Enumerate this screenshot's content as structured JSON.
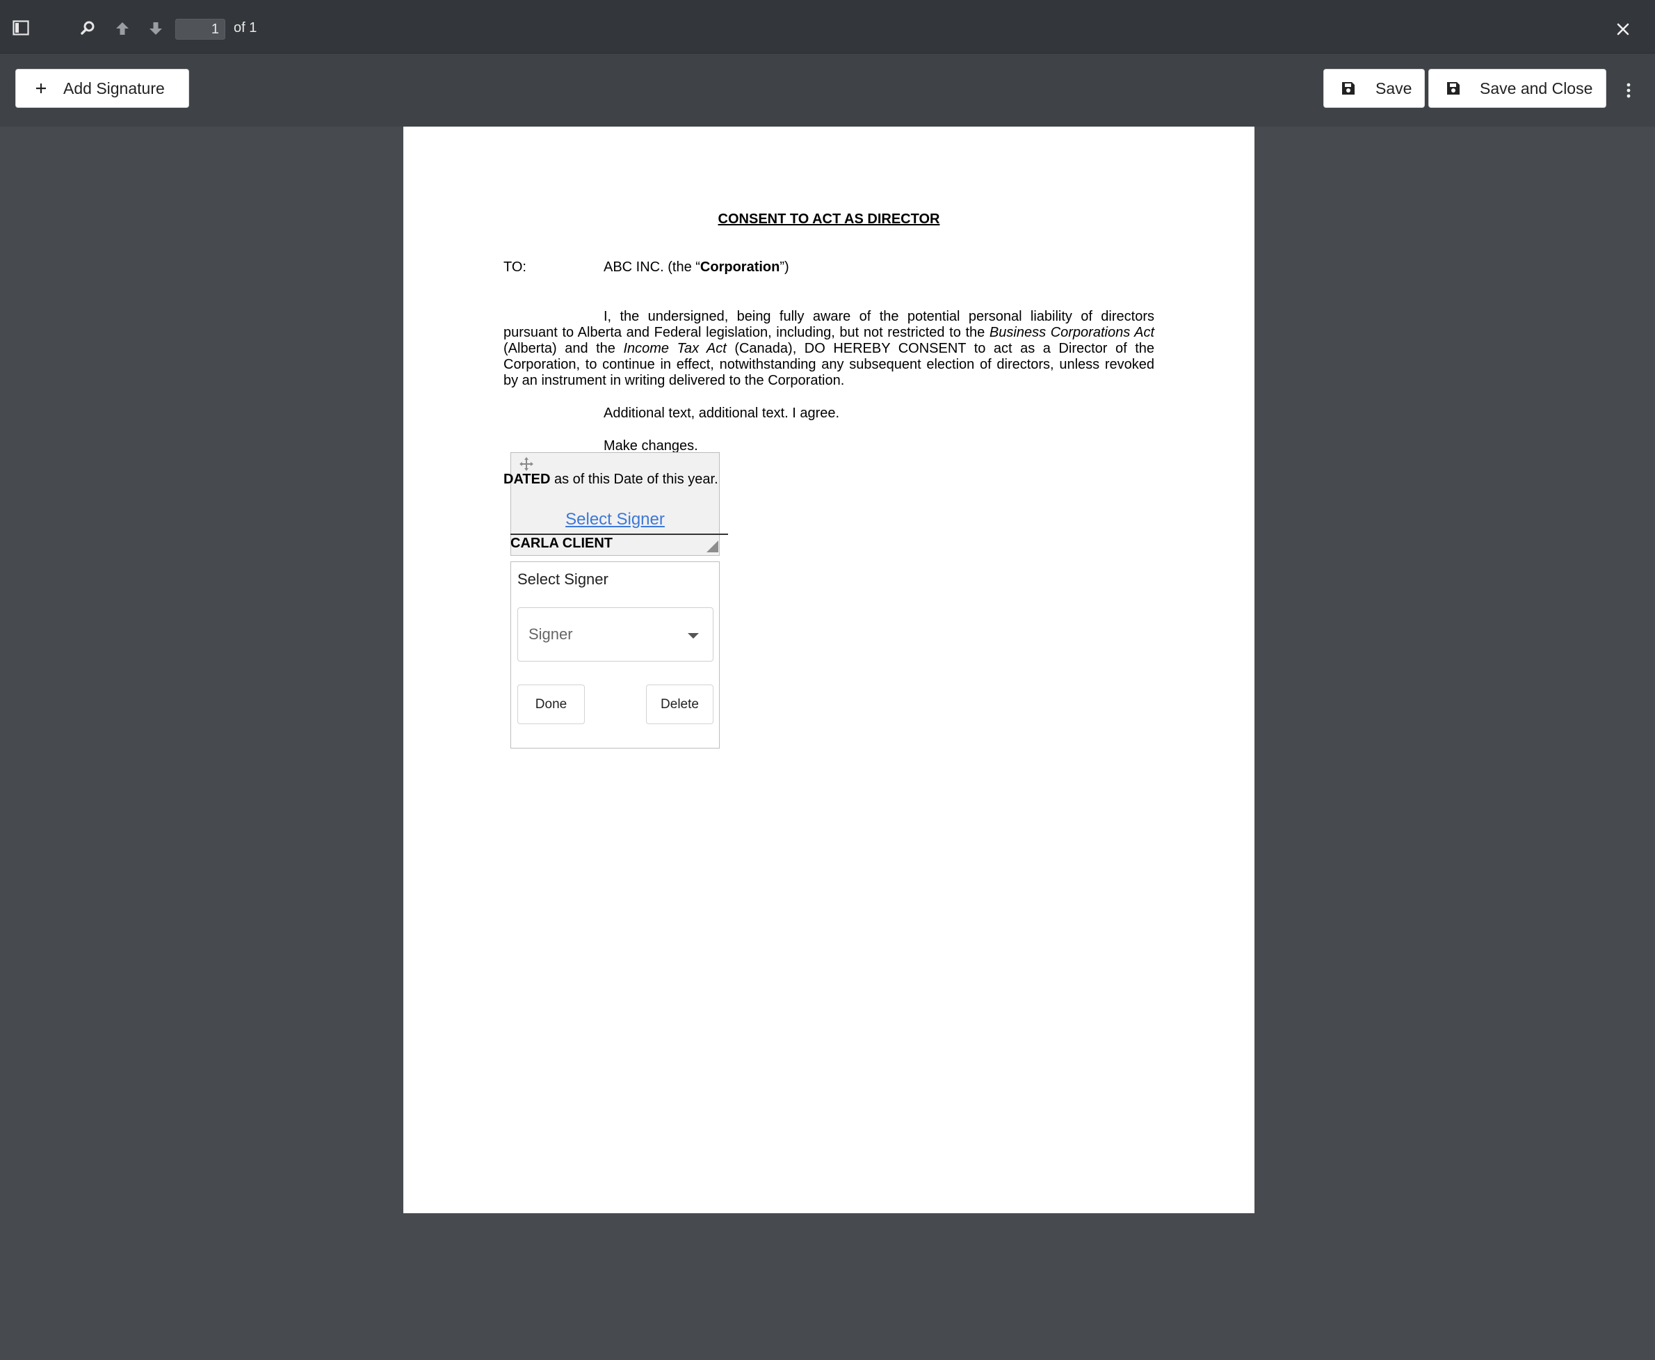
{
  "viewer": {
    "page_current": "1",
    "page_of": "of 1"
  },
  "actions": {
    "add_signature": "Add Signature",
    "save": "Save",
    "save_and_close": "Save and Close"
  },
  "document": {
    "title": "CONSENT TO ACT AS DIRECTOR",
    "to_label": "TO:",
    "to_prefix": "ABC INC. (the “",
    "to_bold": "Corporation",
    "to_suffix": "”)",
    "para_1": "I, the undersigned, being fully aware of the potential personal liability of directors pursuant to Alberta and Federal legislation, including, but not restricted to the ",
    "para_italic_1": "Business Corporations Act",
    "para_2": " (Alberta) and the ",
    "para_italic_2": "Income Tax Act",
    "para_3": " (Canada), DO HEREBY CONSENT to act as a Director of the Corporation, to continue in effect, notwithstanding any subsequent election of directors, unless revoked by an instrument in writing delivered to the Corporation.",
    "line_additional": "Additional text, additional text. I agree.",
    "line_changes": "Make changes.",
    "dated_bold": "DATED",
    "dated_rest": " as of this Date of this year.",
    "signer_name": "CARLA CLIENT"
  },
  "signature_widget": {
    "link": "Select Signer",
    "panel_title": "Select Signer",
    "select_placeholder": "Signer",
    "done": "Done",
    "delete": "Delete"
  },
  "icons": [
    "sidebar-toggle-icon",
    "search-icon",
    "arrow-up-icon",
    "arrow-down-icon",
    "close-icon",
    "plus-icon",
    "save-icon",
    "more-vertical-icon",
    "move-icon",
    "chevron-down-icon"
  ]
}
